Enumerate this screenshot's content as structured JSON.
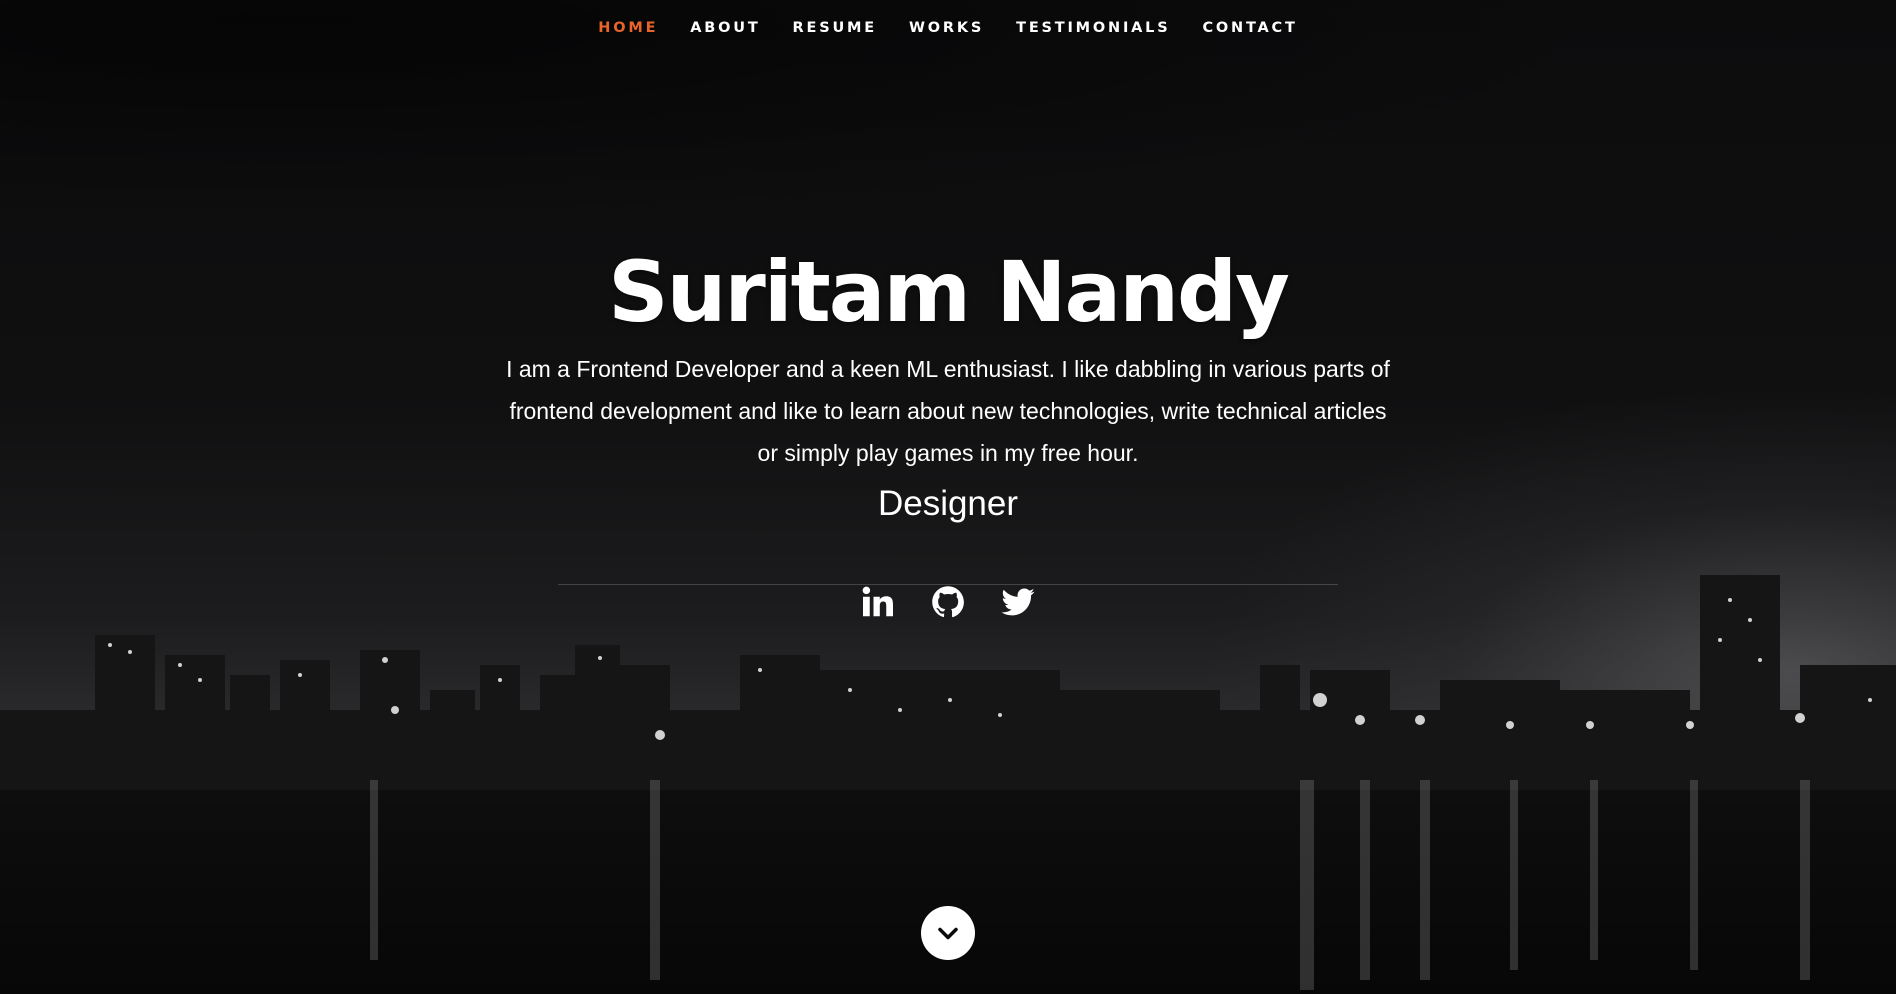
{
  "nav": {
    "items": [
      {
        "label": "HOME",
        "active": true
      },
      {
        "label": "ABOUT",
        "active": false
      },
      {
        "label": "RESUME",
        "active": false
      },
      {
        "label": "WORKS",
        "active": false
      },
      {
        "label": "TESTIMONIALS",
        "active": false
      },
      {
        "label": "CONTACT",
        "active": false
      }
    ],
    "active_color": "#e8642b"
  },
  "hero": {
    "name": "Suritam Nandy",
    "bio": "I am a Frontend Developer and a keen ML enthusiast. I like dabbling in various parts of frontend development and like to learn about new technologies, write technical articles or simply play games in my free hour.",
    "role": "Designer"
  },
  "social": [
    {
      "icon": "linkedin-icon"
    },
    {
      "icon": "github-icon"
    },
    {
      "icon": "twitter-icon"
    }
  ],
  "scroll_button": {
    "icon": "chevron-down-icon"
  }
}
